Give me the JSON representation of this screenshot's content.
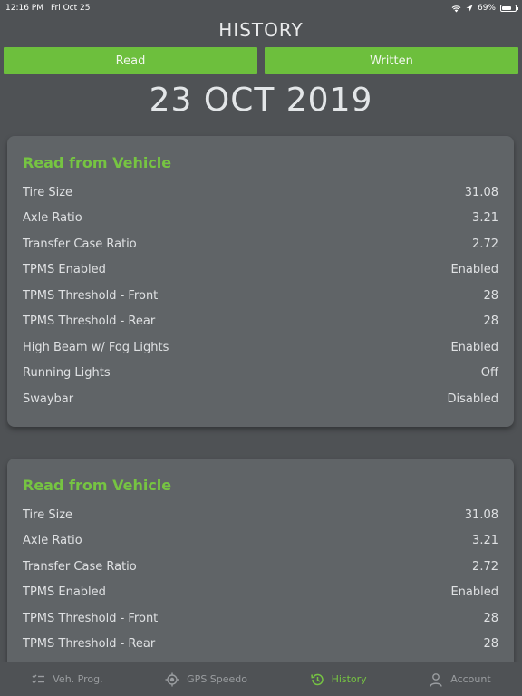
{
  "status": {
    "time": "12:16 PM",
    "date": "Fri Oct 25",
    "battery": "69%",
    "battery_level": 0.69
  },
  "header": {
    "title": "HISTORY"
  },
  "tabs": [
    {
      "label": "Read"
    },
    {
      "label": "Written"
    }
  ],
  "date_heading": "23 OCT 2019",
  "cards": [
    {
      "title": "Read from Vehicle",
      "rows": [
        {
          "label": "Tire Size",
          "value": "31.08"
        },
        {
          "label": "Axle Ratio",
          "value": "3.21"
        },
        {
          "label": "Transfer Case Ratio",
          "value": "2.72"
        },
        {
          "label": "TPMS Enabled",
          "value": "Enabled"
        },
        {
          "label": "TPMS Threshold - Front",
          "value": "28"
        },
        {
          "label": "TPMS Threshold - Rear",
          "value": "28"
        },
        {
          "label": "High Beam w/ Fog Lights",
          "value": "Enabled"
        },
        {
          "label": "Running Lights",
          "value": "Off"
        },
        {
          "label": "Swaybar",
          "value": "Disabled"
        }
      ]
    },
    {
      "title": "Read from Vehicle",
      "rows": [
        {
          "label": "Tire Size",
          "value": "31.08"
        },
        {
          "label": "Axle Ratio",
          "value": "3.21"
        },
        {
          "label": "Transfer Case Ratio",
          "value": "2.72"
        },
        {
          "label": "TPMS Enabled",
          "value": "Enabled"
        },
        {
          "label": "TPMS Threshold - Front",
          "value": "28"
        },
        {
          "label": "TPMS Threshold - Rear",
          "value": "28"
        }
      ]
    }
  ],
  "nav": [
    {
      "label": "Veh. Prog.",
      "icon": "checklist-icon",
      "active": false
    },
    {
      "label": "GPS Speedo",
      "icon": "gps-target-icon",
      "active": false
    },
    {
      "label": "History",
      "icon": "history-icon",
      "active": true
    },
    {
      "label": "Account",
      "icon": "account-icon",
      "active": false
    }
  ],
  "colors": {
    "accent": "#6dbf3d",
    "background": "#4f5255",
    "card": "#606467"
  }
}
